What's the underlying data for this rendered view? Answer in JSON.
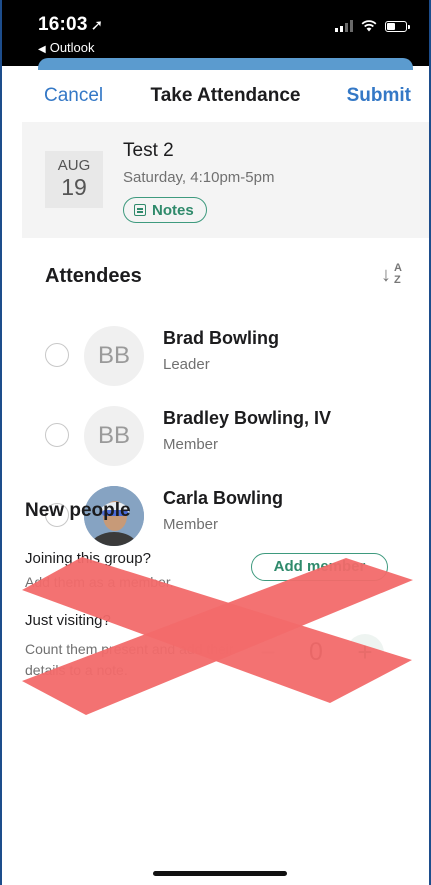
{
  "status_bar": {
    "time": "16:03",
    "back_app": "Outlook"
  },
  "nav": {
    "cancel": "Cancel",
    "title": "Take Attendance",
    "submit": "Submit"
  },
  "event": {
    "month": "AUG",
    "day": "19",
    "title": "Test 2",
    "subtitle": "Saturday, 4:10pm-5pm",
    "notes_label": "Notes"
  },
  "attendees": {
    "title": "Attendees",
    "sort_icon": "sort-az-icon",
    "people": [
      {
        "initials": "BB",
        "name": "Brad Bowling",
        "role": "Leader",
        "checked": false
      },
      {
        "initials": "BB",
        "name": "Bradley Bowling, IV",
        "role": "Member",
        "checked": false
      },
      {
        "initials": "",
        "name": "Carla Bowling",
        "role": "Member",
        "checked": false
      }
    ]
  },
  "new_people": {
    "title": "New people",
    "joining_question": "Joining this group?",
    "joining_sub": "Add them as a member.",
    "add_member_label": "Add member",
    "visiting_question": "Just visiting?",
    "visiting_sub": "Count them present and add their details to a note.",
    "visitor_count": "0"
  },
  "colors": {
    "accent_blue": "#3478c6",
    "accent_green": "#2f8a6b",
    "strike_red": "#f26a6a"
  }
}
